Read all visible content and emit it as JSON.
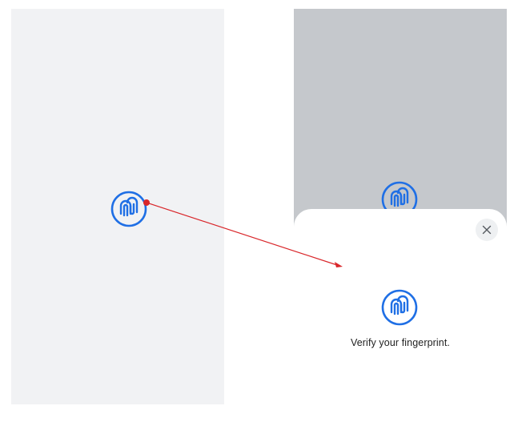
{
  "left_screen": {
    "fingerprint_icon": "fingerprint-icon"
  },
  "right_screen": {
    "background_fingerprint_icon": "fingerprint-icon",
    "dialog": {
      "close_icon": "close-icon",
      "fingerprint_icon": "fingerprint-icon",
      "message": "Verify your fingerprint."
    }
  },
  "colors": {
    "accent": "#1f6fe5",
    "arrow": "#d9262a",
    "left_bg": "#f1f2f4",
    "right_bg": "#c5c8cc"
  }
}
